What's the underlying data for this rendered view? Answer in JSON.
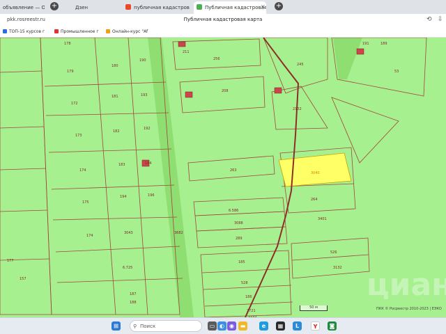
{
  "browser": {
    "tabs": [
      {
        "label": "объявление — Об",
        "active": false
      },
      {
        "label": "Дзен",
        "active": false
      },
      {
        "label": "публичная кадастровая к",
        "active": false
      },
      {
        "label": "Публичная кадастровая ка",
        "active": true
      }
    ],
    "url": "pkk.rosreestr.ru",
    "page_title": "Публичная кадастровая карта",
    "bookmarks": [
      "ТОП-15 курсов г",
      "Промышленное г",
      "Онлайн-курс \"Af"
    ]
  },
  "map": {
    "parcel_labels": [
      "178",
      "256",
      "179",
      "180",
      "190",
      "191",
      "211",
      "245",
      "189",
      "53",
      "172",
      "181",
      "193",
      "208",
      "2132",
      "182",
      "173",
      "192",
      "174",
      "183",
      "184",
      "263",
      "3040",
      "175",
      "194",
      "196",
      "264",
      "3401",
      "6.586",
      "3088",
      "289",
      "174",
      "3043",
      "177",
      "185",
      "6.725",
      "3682",
      "528",
      "526",
      "3132",
      "186",
      "187",
      "3721",
      "157",
      "188",
      "3434"
    ],
    "scale_label": "50 м",
    "attribution": "ПКК © Росреестр 2010-2023 | ЕЭКО",
    "watermark": "циан",
    "colors": {
      "background": "#a7f08f",
      "parcel_border": "#a0463c",
      "selected_parcel": "#ffff66",
      "road": "#8b2f2a",
      "highlight_strip": "#7ad860"
    }
  },
  "taskbar": {
    "search_placeholder": "Поиск",
    "icons": [
      "windows-start-icon",
      "search-icon",
      "task-view-icon",
      "widgets-icon",
      "chat-icon",
      "file-explorer-icon",
      "edge-icon",
      "store-icon",
      "l-app-icon",
      "yandex-icon",
      "terminal-icon"
    ]
  }
}
